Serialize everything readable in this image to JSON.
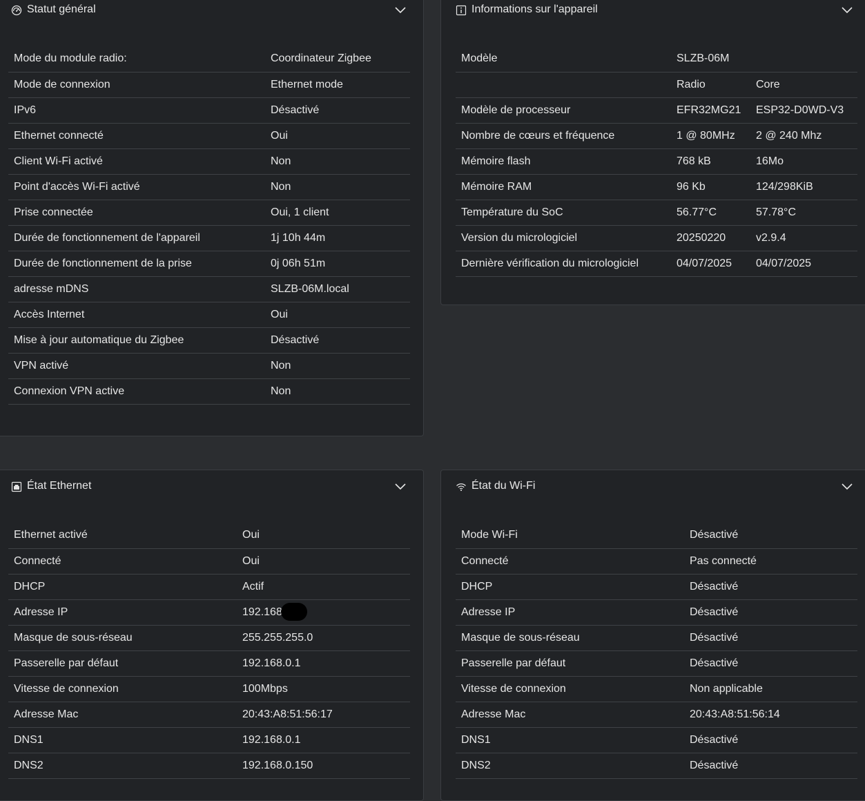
{
  "status": {
    "title": "Statut général",
    "rows": [
      {
        "label": "Mode du module radio:",
        "value": "Coordinateur Zigbee"
      },
      {
        "label": "Mode de connexion",
        "value": "Ethernet mode"
      },
      {
        "label": "IPv6",
        "value": "Désactivé"
      },
      {
        "label": "Ethernet connecté",
        "value": "Oui"
      },
      {
        "label": "Client Wi-Fi activé",
        "value": "Non"
      },
      {
        "label": "Point d'accès Wi-Fi activé",
        "value": "Non"
      },
      {
        "label": "Prise connectée",
        "value": "Oui, 1 client"
      },
      {
        "label": "Durée de fonctionnement de l'appareil",
        "value": "1j 10h 44m"
      },
      {
        "label": "Durée de fonctionnement de la prise",
        "value": "0j 06h 51m"
      },
      {
        "label": "adresse mDNS",
        "value": "SLZB-06M.local"
      },
      {
        "label": "Accès Internet",
        "value": "Oui"
      },
      {
        "label": "Mise à jour automatique du Zigbee",
        "value": "Désactivé"
      },
      {
        "label": "VPN activé",
        "value": "Non"
      },
      {
        "label": "Connexion VPN active",
        "value": "Non"
      }
    ]
  },
  "device": {
    "title": "Informations sur l'appareil",
    "rows": [
      {
        "label": "Modèle",
        "radio": "SLZB-06M",
        "core": ""
      },
      {
        "label": "",
        "radio": "Radio",
        "core": "Core"
      },
      {
        "label": "Modèle de processeur",
        "radio": "EFR32MG21",
        "core": "ESP32-D0WD-V3"
      },
      {
        "label": "Nombre de cœurs et fréquence",
        "radio": "1 @ 80MHz",
        "core": "2 @ 240 Mhz"
      },
      {
        "label": "Mémoire flash",
        "radio": "768 kB",
        "core": "16Mo"
      },
      {
        "label": "Mémoire RAM",
        "radio": "96 Kb",
        "core": "124/298KiB"
      },
      {
        "label": "Température du SoC",
        "radio": "56.77°C",
        "core": "57.78°C"
      },
      {
        "label": "Version du micrologiciel",
        "radio": "20250220",
        "core": "v2.9.4"
      },
      {
        "label": "Dernière vérification du micrologiciel",
        "radio": "04/07/2025",
        "core": "04/07/2025"
      }
    ]
  },
  "ethernet": {
    "title": "État Ethernet",
    "rows": [
      {
        "label": "Ethernet activé",
        "value": "Oui"
      },
      {
        "label": "Connecté",
        "value": "Oui"
      },
      {
        "label": "DHCP",
        "value": "Actif"
      },
      {
        "label": "Adresse IP",
        "value": "192.168"
      },
      {
        "label": "Masque de sous-réseau",
        "value": "255.255.255.0"
      },
      {
        "label": "Passerelle par défaut",
        "value": "192.168.0.1"
      },
      {
        "label": "Vitesse de connexion",
        "value": "100Mbps"
      },
      {
        "label": "Adresse Mac",
        "value": "20:43:A8:51:56:17"
      },
      {
        "label": "DNS1",
        "value": "192.168.0.1"
      },
      {
        "label": "DNS2",
        "value": "192.168.0.150"
      }
    ]
  },
  "wifi": {
    "title": "État du Wi-Fi",
    "rows": [
      {
        "label": "Mode Wi-Fi",
        "value": "Désactivé"
      },
      {
        "label": "Connecté",
        "value": "Pas connecté"
      },
      {
        "label": "DHCP",
        "value": "Désactivé"
      },
      {
        "label": "Adresse IP",
        "value": "Désactivé"
      },
      {
        "label": "Masque de sous-réseau",
        "value": "Désactivé"
      },
      {
        "label": "Passerelle par défaut",
        "value": "Désactivé"
      },
      {
        "label": "Vitesse de connexion",
        "value": "Non applicable"
      },
      {
        "label": "Adresse Mac",
        "value": "20:43:A8:51:56:14"
      },
      {
        "label": "DNS1",
        "value": "Désactivé"
      },
      {
        "label": "DNS2",
        "value": "Désactivé"
      }
    ]
  },
  "icons": {
    "status": "gauge-icon",
    "device": "info-icon",
    "ethernet": "ethernet-icon",
    "wifi": "wifi-icon",
    "collapse": "chevron-down-icon"
  }
}
